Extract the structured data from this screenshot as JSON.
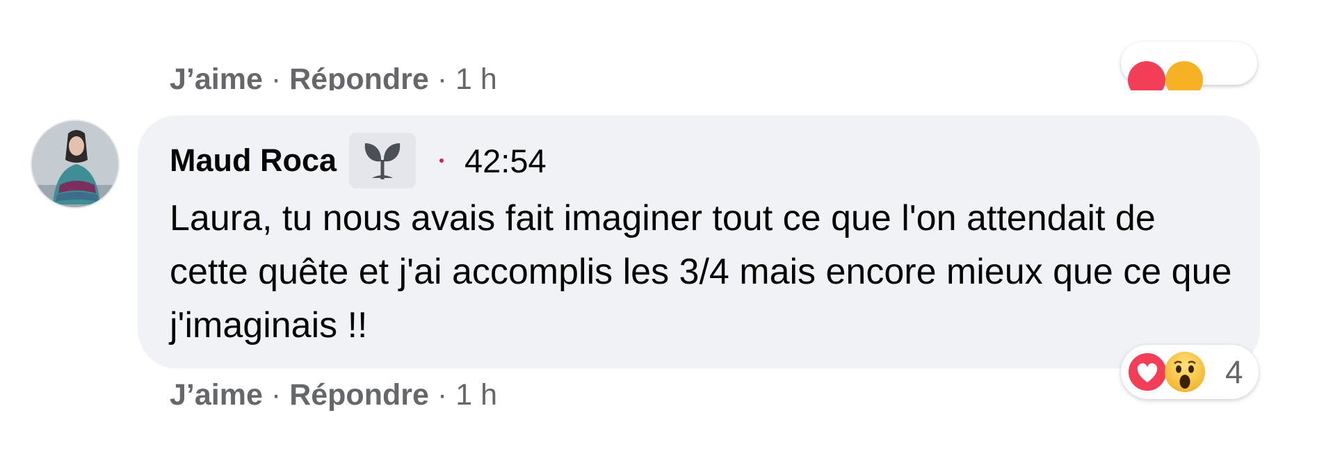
{
  "previous_comment": {
    "like_label": "J’aime",
    "reply_label": "Répondre",
    "separator": "·",
    "time": "1 h"
  },
  "comment": {
    "author": "Maud Roca",
    "badge_icon": "sprout-icon",
    "timestamp": "42:54",
    "text": "Laura, tu nous avais fait imaginer tout ce que l'on attendait de cette quête et j'ai accomplis les 3/4 mais encore mieux que ce que j'imaginais !!",
    "reactions": {
      "icons": [
        "love-reaction-icon",
        "wow-reaction-icon"
      ],
      "count": "4"
    },
    "actions": {
      "like_label": "J’aime",
      "reply_label": "Répondre",
      "separator": "·",
      "time": "1 h"
    }
  },
  "colors": {
    "bubble_bg": "#f0f2f5",
    "secondary_text": "#65676b",
    "love_red": "#f33e58",
    "wow_yellow": "#f7c944"
  }
}
